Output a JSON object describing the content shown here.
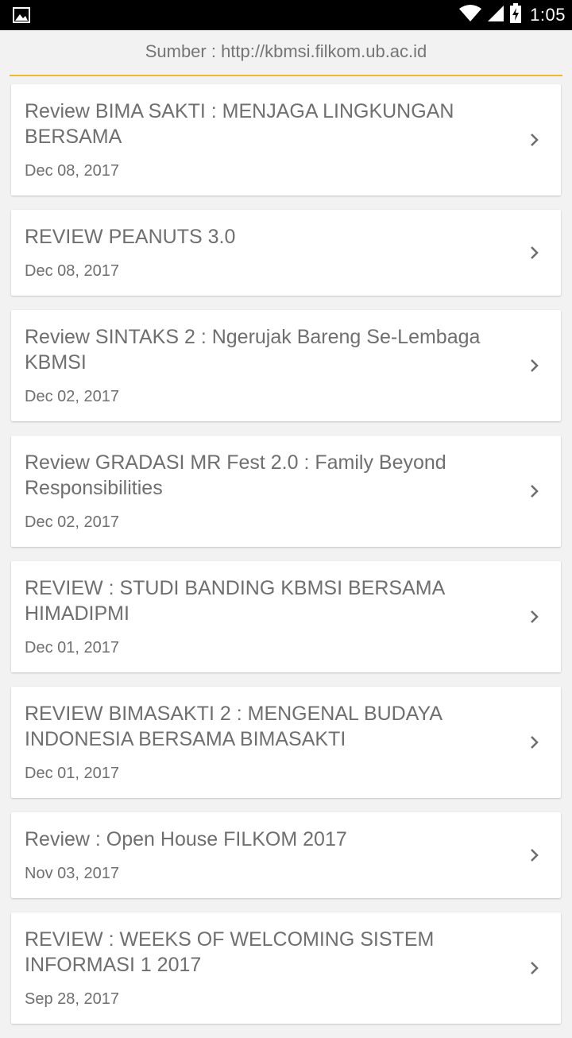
{
  "status_bar": {
    "time": "1:05",
    "icons": [
      "image-icon",
      "wifi-icon",
      "signal-icon",
      "battery-charging-icon"
    ]
  },
  "source": {
    "text": "Sumber : http://kbmsi.filkom.ub.ac.id",
    "accent_color": "#f0b731"
  },
  "articles": [
    {
      "title": "Review BIMA SAKTI : MENJAGA LINGKUNGAN BERSAMA",
      "date": "Dec 08, 2017"
    },
    {
      "title": "REVIEW PEANUTS 3.0",
      "date": "Dec 08, 2017"
    },
    {
      "title": "Review SINTAKS 2 : Ngerujak Bareng Se-Lembaga KBMSI",
      "date": "Dec 02, 2017"
    },
    {
      "title": "Review GRADASI MR Fest 2.0 : Family Beyond Responsibilities",
      "date": "Dec 02, 2017"
    },
    {
      "title": "REVIEW : STUDI BANDING KBMSI BERSAMA HIMADIPMI",
      "date": "Dec 01, 2017"
    },
    {
      "title": "REVIEW BIMASAKTI 2 : MENGENAL BUDAYA INDONESIA BERSAMA BIMASAKTI",
      "date": "Dec 01, 2017"
    },
    {
      "title": "Review : Open House FILKOM 2017",
      "date": "Nov 03, 2017"
    },
    {
      "title": "REVIEW : WEEKS OF WELCOMING SISTEM INFORMASI 1 2017",
      "date": "Sep 28, 2017"
    }
  ]
}
